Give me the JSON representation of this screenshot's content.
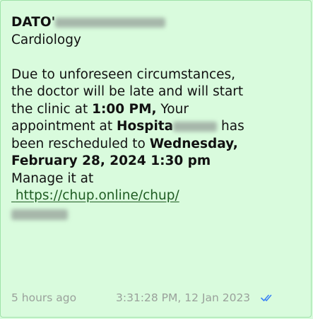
{
  "message": {
    "doctor_prefix": "DATO'",
    "specialty": "Cardiology",
    "lines": [
      "Due to unforeseen circumstances,",
      "the doctor will be late and will start",
      "the clinic at ",
      "1:00 PM,",
      " Your",
      "appointment at ",
      "Hospita",
      " has",
      "been rescheduled to ",
      "Wednesday,",
      "February 28, 2024 1:30 pm",
      "Manage it at"
    ],
    "link_text": "https://chup.online/chup/"
  },
  "footer": {
    "relative_time": "5 hours ago",
    "timestamp": "3:31:28 PM, 12 Jan 2023",
    "read_status_icon": "double-check-icon"
  },
  "colors": {
    "bubble": "#d9fbdd",
    "link": "#1f5c22",
    "ticks": "#3b82f6",
    "meta_text": "#9aa19b"
  }
}
